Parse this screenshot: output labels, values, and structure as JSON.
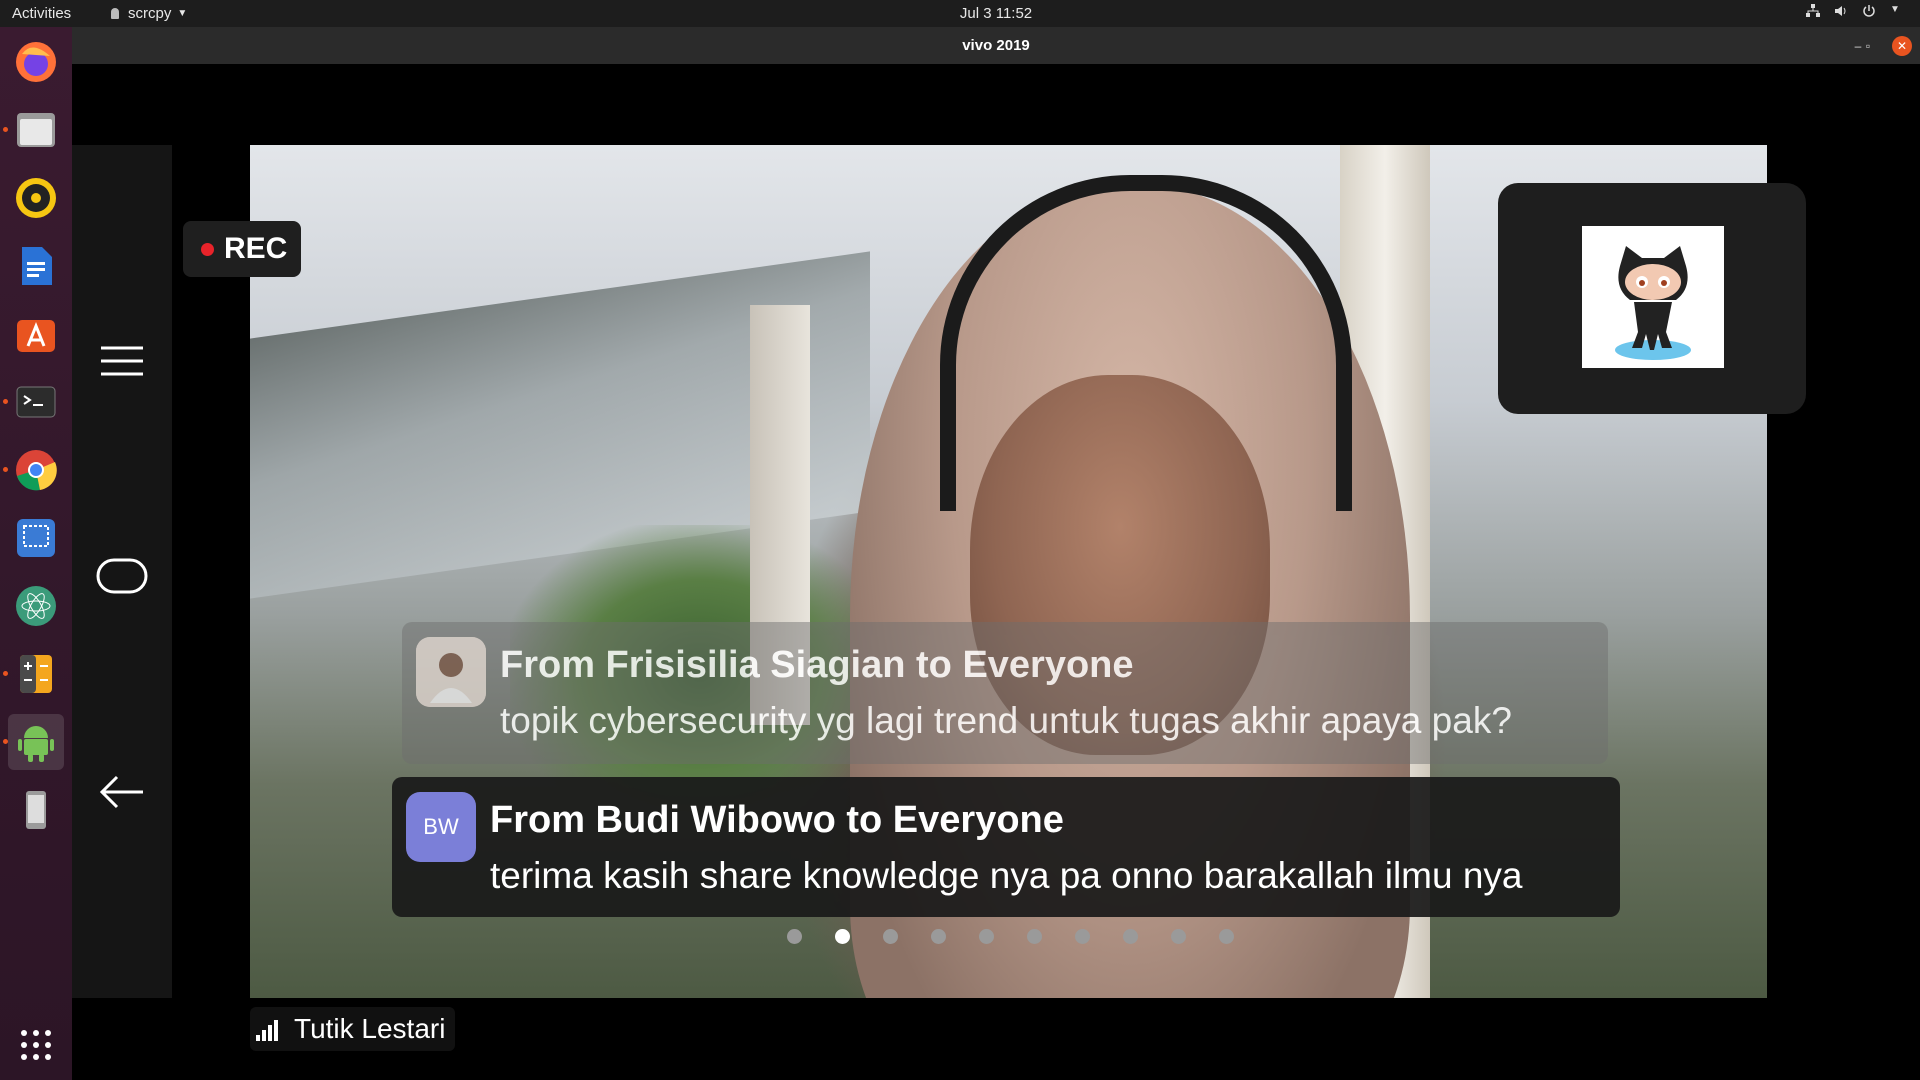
{
  "topbar": {
    "activities": "Activities",
    "app_name": "scrcpy",
    "clock": "Jul 3  11:52"
  },
  "dock": {
    "items": [
      {
        "name": "firefox-icon",
        "color": "#ff7139"
      },
      {
        "name": "files-icon",
        "color": "#c9c9c9"
      },
      {
        "name": "rhythmbox-icon",
        "color": "#f6c612"
      },
      {
        "name": "libreoffice-writer-icon",
        "color": "#2a72d6"
      },
      {
        "name": "ubuntu-software-icon",
        "color": "#e95420"
      },
      {
        "name": "terminal-icon",
        "color": "#2c2c2c"
      },
      {
        "name": "chrome-icon",
        "color": "#4285f4"
      },
      {
        "name": "screenshot-icon",
        "color": "#3a7bd5"
      },
      {
        "name": "atom-icon",
        "color": "#3b9b7a"
      },
      {
        "name": "calculator-icon",
        "color": "#f4a61e"
      },
      {
        "name": "android-icon",
        "color": "#78c257"
      },
      {
        "name": "phone-device-icon",
        "color": "#9b9b9b"
      }
    ],
    "apps_grid": "show-applications-icon"
  },
  "window": {
    "title": "vivo 2019"
  },
  "meeting": {
    "rec_label": "REC",
    "participant_name": "Tutik Lestari",
    "self_view_icon": "octocat-icon",
    "chat": [
      {
        "from": "From Frisisilia Siagian to Everyone",
        "message": "topik cybersecurity yg lagi trend untuk tugas akhir apaya pak?",
        "avatar_initials": ""
      },
      {
        "from": "From Budi Wibowo to Everyone",
        "message": "terima kasih share knowledge nya pa onno barakallah ilmu nya",
        "avatar_initials": "BW"
      }
    ],
    "page_dots_total": 10,
    "page_dots_active": 2,
    "avatar_color": "#7b7fd8"
  }
}
